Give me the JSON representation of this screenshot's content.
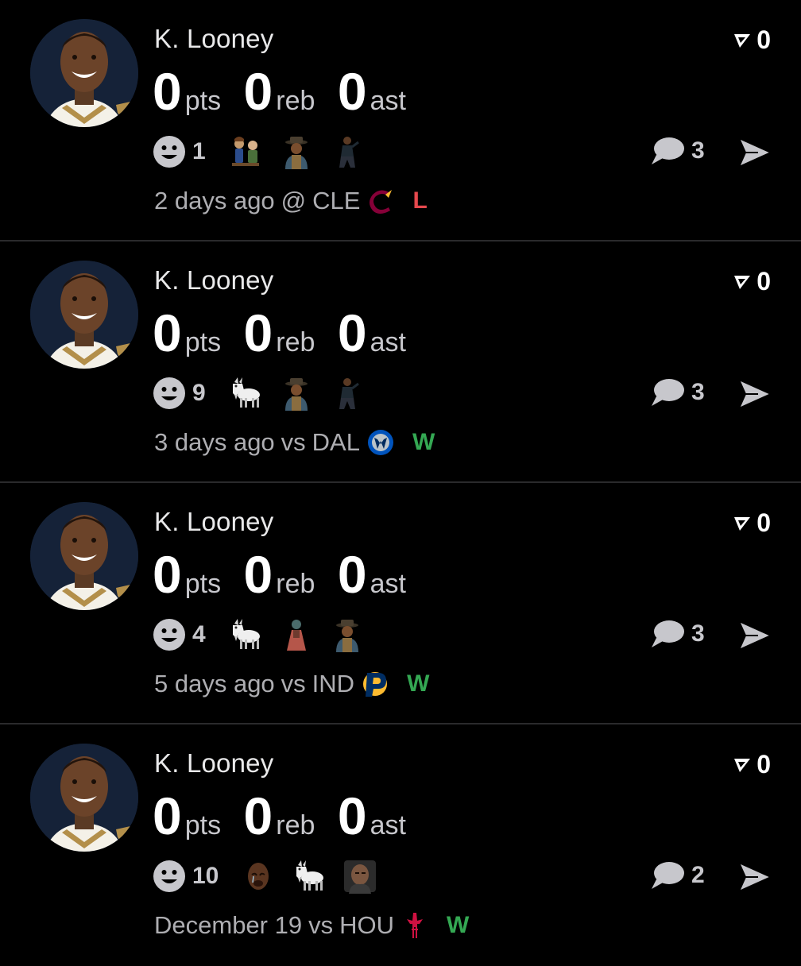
{
  "posts": [
    {
      "player_name": "K. Looney",
      "stats": [
        {
          "value": "0",
          "unit": "pts"
        },
        {
          "value": "0",
          "unit": "reb"
        },
        {
          "value": "0",
          "unit": "ast"
        }
      ],
      "upvote_count": "0",
      "reaction_count": "1",
      "reaction_emojis": [
        "toy-figures-emoji",
        "hat-man-emoji",
        "dancing-man-emoji"
      ],
      "comment_count": "3",
      "game_time": "2 days ago",
      "game_connector": "@",
      "opponent": "CLE",
      "opponent_logo": "cavaliers-logo",
      "result": "L",
      "result_color": "#e5484d"
    },
    {
      "player_name": "K. Looney",
      "stats": [
        {
          "value": "0",
          "unit": "pts"
        },
        {
          "value": "0",
          "unit": "reb"
        },
        {
          "value": "0",
          "unit": "ast"
        }
      ],
      "upvote_count": "0",
      "reaction_count": "9",
      "reaction_emojis": [
        "goat-emoji",
        "hat-man-emoji",
        "dancing-man-emoji"
      ],
      "comment_count": "3",
      "game_time": "3 days ago",
      "game_connector": "vs",
      "opponent": "DAL",
      "opponent_logo": "mavericks-logo",
      "result": "W",
      "result_color": "#34a853"
    },
    {
      "player_name": "K. Looney",
      "stats": [
        {
          "value": "0",
          "unit": "pts"
        },
        {
          "value": "0",
          "unit": "reb"
        },
        {
          "value": "0",
          "unit": "ast"
        }
      ],
      "upvote_count": "0",
      "reaction_count": "4",
      "reaction_emojis": [
        "goat-emoji",
        "person-emoji",
        "hat-man-emoji"
      ],
      "comment_count": "3",
      "game_time": "5 days ago",
      "game_connector": "vs",
      "opponent": "IND",
      "opponent_logo": "pacers-logo",
      "result": "W",
      "result_color": "#34a853"
    },
    {
      "player_name": "K. Looney",
      "stats": [
        {
          "value": "0",
          "unit": "pts"
        },
        {
          "value": "0",
          "unit": "reb"
        },
        {
          "value": "0",
          "unit": "ast"
        }
      ],
      "upvote_count": "0",
      "reaction_count": "10",
      "reaction_emojis": [
        "crying-face-emoji",
        "goat-emoji",
        "man-face-emoji"
      ],
      "comment_count": "2",
      "game_time": "December 19",
      "game_connector": "vs",
      "opponent": "HOU",
      "opponent_logo": "rockets-logo",
      "result": "W",
      "result_color": "#34a853"
    }
  ]
}
